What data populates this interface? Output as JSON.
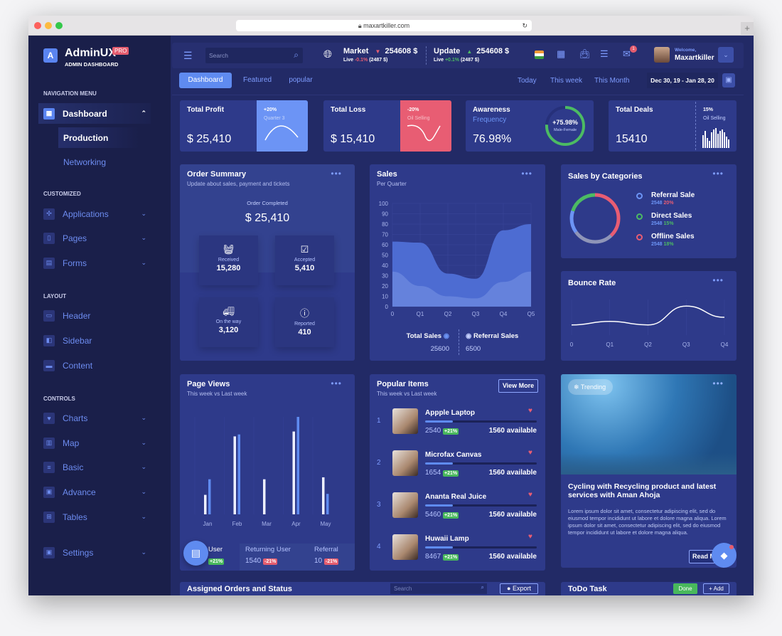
{
  "browser": {
    "url": "maxartkiller.com"
  },
  "brand": {
    "name": "AdminUX",
    "badge": "PRO",
    "subtitle": "ADMIN DASHBOARD"
  },
  "sidebar": {
    "sections": [
      {
        "label": "NAVIGATION MENU"
      },
      {
        "label": "CUSTOMIZED"
      },
      {
        "label": "LAYOUT"
      },
      {
        "label": "CONTROLS"
      }
    ],
    "items": [
      {
        "label": "Dashboard",
        "icon": "dashboard-icon",
        "chevron": "up",
        "active": true
      },
      {
        "label": "Production",
        "sub": true,
        "active": true
      },
      {
        "label": "Networking",
        "sub": true
      },
      {
        "label": "Applications",
        "icon": "apps-icon",
        "chevron": "down"
      },
      {
        "label": "Pages",
        "icon": "bookmark-icon",
        "chevron": "down"
      },
      {
        "label": "Forms",
        "icon": "forms-icon",
        "chevron": "down"
      },
      {
        "label": "Header",
        "icon": "header-icon"
      },
      {
        "label": "Sidebar",
        "icon": "sidebar-icon"
      },
      {
        "label": "Content",
        "icon": "content-icon"
      },
      {
        "label": "Charts",
        "icon": "heart-icon",
        "chevron": "down"
      },
      {
        "label": "Map",
        "icon": "map-icon",
        "chevron": "down"
      },
      {
        "label": "Basic",
        "icon": "list-icon",
        "chevron": "down"
      },
      {
        "label": "Advance",
        "icon": "calendar-icon",
        "chevron": "down"
      },
      {
        "label": "Tables",
        "icon": "table-icon",
        "chevron": "down"
      },
      {
        "label": "Settings",
        "icon": "settings-icon",
        "chevron": "down"
      }
    ]
  },
  "topbar": {
    "search_placeholder": "Search",
    "market": {
      "label": "Market",
      "value": "254608 $",
      "live": "Live",
      "change": "-0.1%",
      "amount": "(2487 $)"
    },
    "update": {
      "label": "Update",
      "value": "254608 $",
      "live": "Live",
      "change": "+0.1%",
      "amount": "(2487 $)"
    },
    "notifications": "1",
    "user": {
      "welcome": "Welcome,",
      "name": "Maxartkiller"
    }
  },
  "tabs": {
    "items": [
      "Dashboard",
      "Featured",
      "popular"
    ],
    "active": 0,
    "periods": [
      "Today",
      "This week",
      "This Month"
    ],
    "date_range": "Dec 30, 19 - Jan 28, 20"
  },
  "stats": [
    {
      "title": "Total Profit",
      "value": "$ 25,410",
      "pct": "+20%",
      "note": "Quarter 3",
      "color": "#6c94f5"
    },
    {
      "title": "Total Loss",
      "value": "$ 15,410",
      "pct": "-20%",
      "note": "Oil Selling",
      "color": "#e85d73"
    },
    {
      "title": "Awareness",
      "sub": "Frequency",
      "value": "76.98%",
      "ring": "+75.98%",
      "ring_label": "Male-Female",
      "ring_fraction": 0.76
    },
    {
      "title": "Total Deals",
      "value": "15410",
      "pct": "15%",
      "note": "Oil Selling"
    }
  ],
  "order_summary": {
    "title": "Order Summary",
    "subtitle": "Update about sales, payment and tickets",
    "completed_label": "Order Completed",
    "completed_value": "$ 25,410",
    "tiles": [
      {
        "label": "Received",
        "value": "15,280",
        "icon": "basket-icon"
      },
      {
        "label": "Accepted",
        "value": "5,410",
        "icon": "calendar-check-icon"
      },
      {
        "label": "On the way",
        "value": "3,120",
        "icon": "truck-icon"
      },
      {
        "label": "Reported",
        "value": "410",
        "icon": "alert-icon"
      }
    ]
  },
  "sales": {
    "title": "Sales",
    "subtitle": "Per Quarter",
    "legend": [
      {
        "label": "Total Sales",
        "value": "25600"
      },
      {
        "label": "Referral Sales",
        "value": "6500"
      }
    ]
  },
  "categories": {
    "title": "Sales by Categories",
    "items": [
      {
        "label": "Referral Sale",
        "value": "2548",
        "pct": "20%",
        "color": "#6c94f5",
        "pct_color": "#e85d73"
      },
      {
        "label": "Direct Sales",
        "value": "2548",
        "pct": "15%",
        "color": "#4cbb63",
        "pct_color": "#4cbb63"
      },
      {
        "label": "Offline Sales",
        "value": "2548",
        "pct": "18%",
        "color": "#e85d73",
        "pct_color": "#4cbb63"
      }
    ]
  },
  "bounce": {
    "title": "Bounce Rate"
  },
  "page_views": {
    "title": "Page Views",
    "subtitle": "This week vs Last week",
    "footer": [
      {
        "label": "User",
        "value": "",
        "badge": "+21%",
        "type": "up"
      },
      {
        "label": "Returning User",
        "value": "1540",
        "badge": "-21%",
        "type": "down"
      },
      {
        "label": "Referral",
        "value": "10",
        "badge": "-21%",
        "type": "down"
      }
    ]
  },
  "popular": {
    "title": "Popular Items",
    "subtitle": "This week vs Last week",
    "view_more": "View More",
    "items": [
      {
        "rank": "1",
        "name": "Appple Laptop",
        "count": "2540",
        "badge": "+21%",
        "available": "1560 available",
        "progress": 0.25
      },
      {
        "rank": "2",
        "name": "Microfax Canvas",
        "count": "1654",
        "badge": "+21%",
        "available": "1560 available",
        "progress": 0.25
      },
      {
        "rank": "3",
        "name": "Ananta Real Juice",
        "count": "5460",
        "badge": "+21%",
        "available": "1560 available",
        "progress": 0.25
      },
      {
        "rank": "4",
        "name": "Huwaii Lamp",
        "count": "8467",
        "badge": "+21%",
        "available": "1560 available",
        "progress": 0.25
      }
    ]
  },
  "trending": {
    "badge": "Trending",
    "title": "Cycling with Recycling product and latest services with Aman Ahoja",
    "body": "Lorem ipsum dolor sit amet, consectetur adipiscing elit, sed do eiusmod tempor incididunt ut labore et dolore magna aliqua. Lorem ipsum dolor sit amet, consectetur adipiscing elit, sed do eiusmod tempor incididunt ut labore et dolore magna aliqua.",
    "button": "Read More"
  },
  "assigned": {
    "title": "Assigned Orders and Status",
    "search_placeholder": "Search",
    "export": "Export"
  },
  "todo": {
    "title": "ToDo Task",
    "done": "Done",
    "add": "+ Add"
  },
  "colors": {
    "accent": "#6c94f5",
    "danger": "#e85d73",
    "success": "#4cbb63",
    "card": "#2e3a8a",
    "sidebar": "#1a1f4a"
  },
  "chart_data": [
    {
      "type": "area",
      "title": "Sales",
      "x": [
        "0",
        "Q1",
        "Q2",
        "Q3",
        "Q4",
        "Q5"
      ],
      "ylim": [
        0,
        100
      ],
      "yticks": [
        0,
        10,
        20,
        30,
        40,
        50,
        60,
        70,
        80,
        90,
        100
      ],
      "grid": true,
      "series": [
        {
          "name": "Total Sales",
          "values": [
            63,
            62,
            32,
            27,
            74,
            80
          ]
        },
        {
          "name": "Referral Sales",
          "values": [
            34,
            20,
            10,
            8,
            24,
            34
          ]
        }
      ]
    },
    {
      "type": "bar",
      "title": "Page Views",
      "categories": [
        "Jan",
        "Feb",
        "Mar",
        "Apr",
        "May"
      ],
      "series": [
        {
          "name": "Last week",
          "values": [
            20,
            80,
            36,
            85,
            38
          ]
        },
        {
          "name": "This week",
          "values": [
            36,
            82,
            0,
            100,
            21
          ]
        }
      ]
    },
    {
      "type": "line",
      "title": "Bounce Rate",
      "x": [
        "0",
        "Q1",
        "Q2",
        "Q3",
        "Q4"
      ],
      "values": [
        20,
        27,
        20,
        57,
        35
      ]
    },
    {
      "type": "pie",
      "title": "Sales by Categories",
      "donut": true,
      "slices": [
        {
          "color": "#e85d73",
          "value": 38
        },
        {
          "color": "#8f95b8",
          "value": 27
        },
        {
          "color": "#6c94f5",
          "value": 15
        },
        {
          "color": "#4cbb63",
          "value": 20
        }
      ]
    }
  ]
}
